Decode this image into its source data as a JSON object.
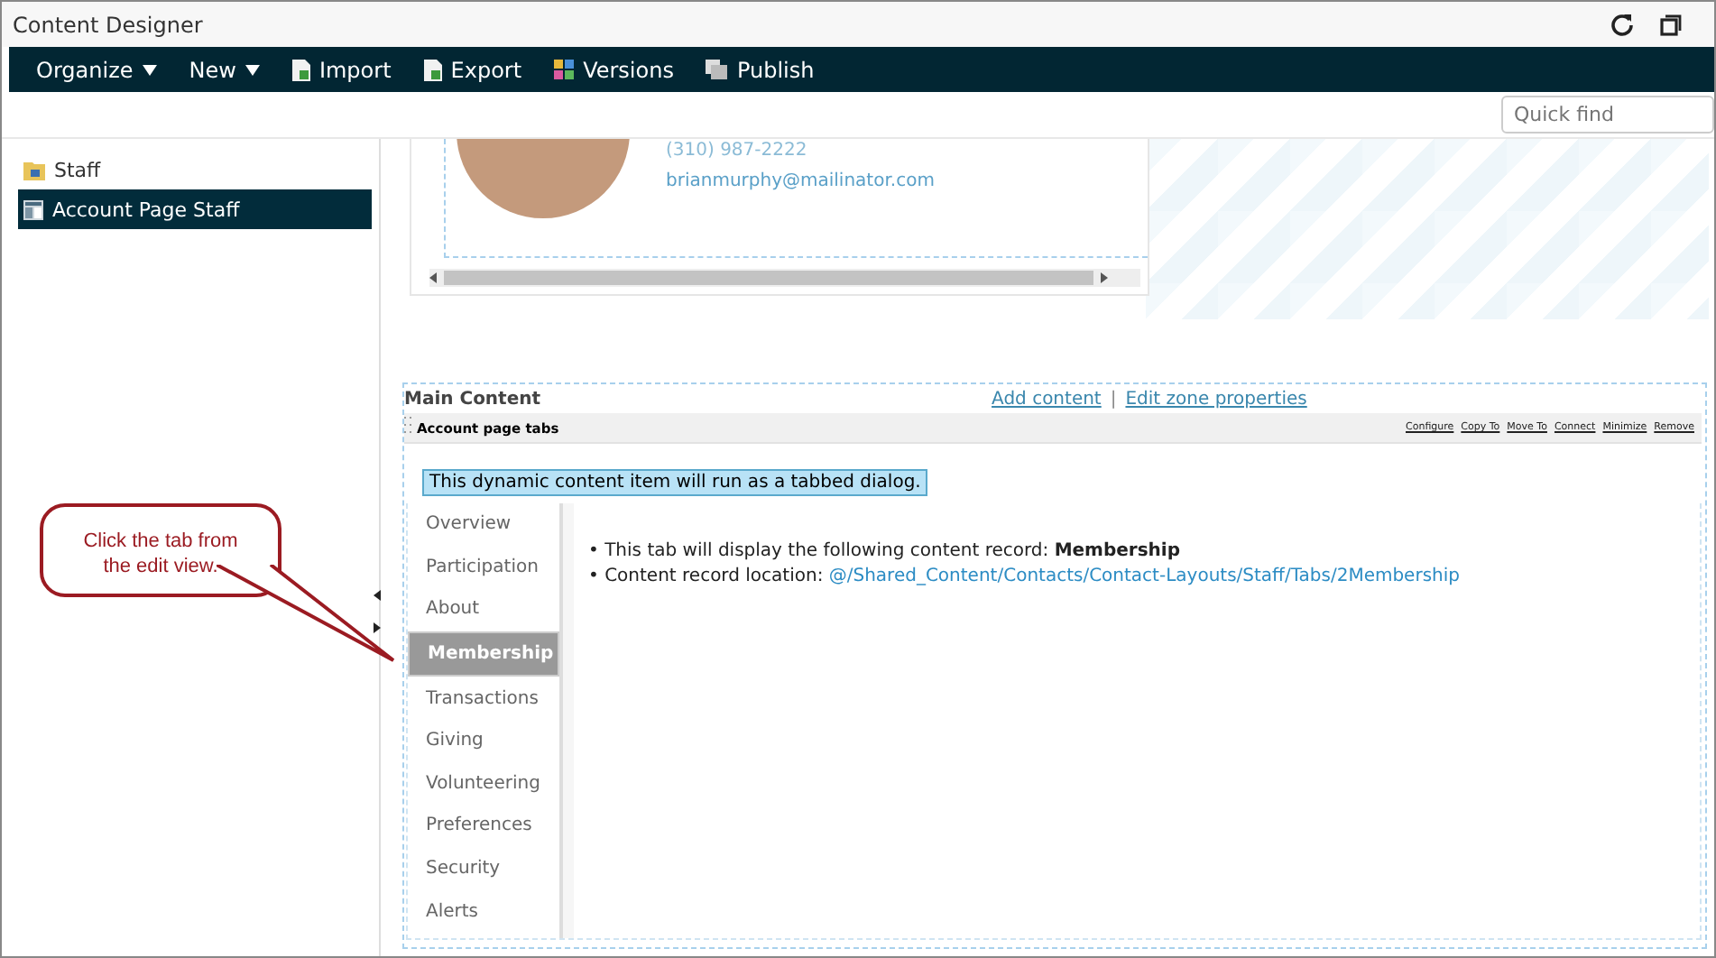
{
  "window": {
    "title": "Content Designer"
  },
  "toolbar": [
    {
      "label": "Organize",
      "kind": "menu"
    },
    {
      "label": "New",
      "kind": "menu"
    },
    {
      "label": "Import",
      "kind": "import"
    },
    {
      "label": "Export",
      "kind": "export"
    },
    {
      "label": "Versions",
      "kind": "versions"
    },
    {
      "label": "Publish",
      "kind": "publish"
    }
  ],
  "search": {
    "placeholder": "Quick find"
  },
  "sidebar": {
    "items": [
      {
        "label": "Staff",
        "kind": "folder",
        "selected": false
      },
      {
        "label": "Account Page Staff",
        "kind": "page",
        "selected": true
      }
    ]
  },
  "profile_card": {
    "phone": "(310) 987-2222",
    "email": "brianmurphy@mailinator.com"
  },
  "zone": {
    "title": "Main Content",
    "links": [
      "Add content",
      "Edit zone properties"
    ],
    "separator": "|",
    "part": {
      "title": "Account page tabs",
      "actions": [
        "Configure",
        "Copy To",
        "Move To",
        "Connect",
        "Minimize",
        "Remove"
      ],
      "notice": "This dynamic content item will run as a tabbed dialog.",
      "tabs": [
        {
          "label": "Overview",
          "selected": false
        },
        {
          "label": "Participation",
          "selected": false
        },
        {
          "label": "About",
          "selected": false
        },
        {
          "label": "Membership",
          "selected": true
        },
        {
          "label": "Transactions",
          "selected": false
        },
        {
          "label": "Giving",
          "selected": false
        },
        {
          "label": "Volunteering",
          "selected": false
        },
        {
          "label": "Preferences",
          "selected": false
        },
        {
          "label": "Security",
          "selected": false
        },
        {
          "label": "Alerts",
          "selected": false
        }
      ],
      "lines": [
        {
          "text": "• This tab will display the following content record: **Membership**"
        },
        {
          "text": "• Content record location: ",
          "link": "@/Shared_Content/Contacts/Contact-Layouts/Staff/Tabs/2Membership"
        }
      ]
    }
  },
  "callout": {
    "text": "Click the tab from the edit view."
  }
}
